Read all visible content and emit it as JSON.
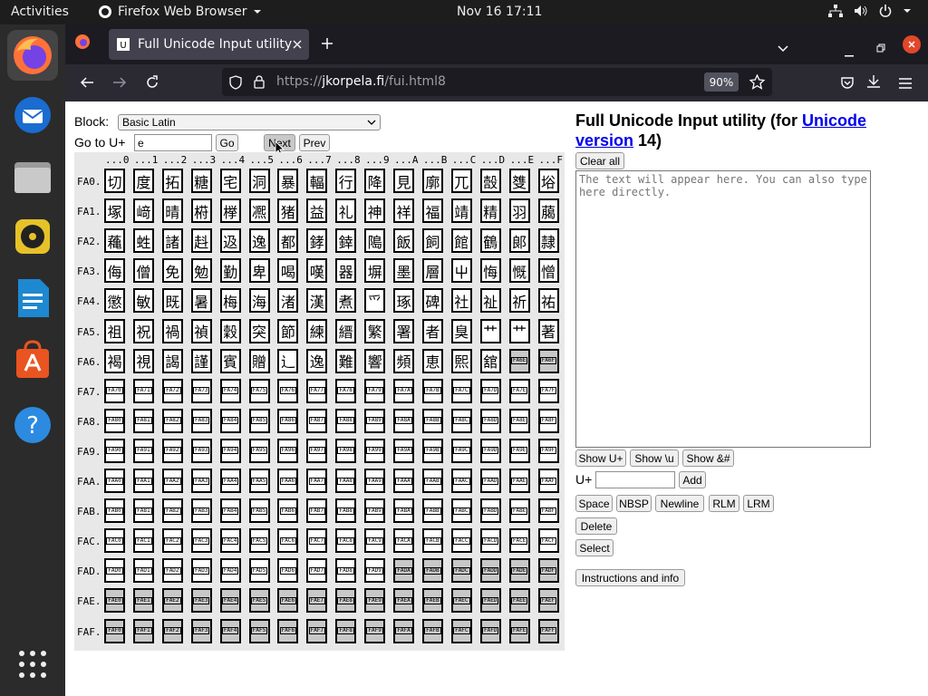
{
  "topbar": {
    "activities": "Activities",
    "app_name": "Firefox Web Browser",
    "datetime": "Nov 16  17:11"
  },
  "browser": {
    "tab_title": "Full Unicode Input utility",
    "url_prefix": "https://",
    "url_domain": "jkorpela.fi",
    "url_path": "/fui.html8",
    "zoom": "90%"
  },
  "page": {
    "block_label": "Block:",
    "block_selected": "Basic Latin",
    "goto_label": "Go to U+",
    "goto_value": "e",
    "go_btn": "Go",
    "next_btn": "Next",
    "prev_btn": "Prev",
    "title_prefix": "Full Unicode Input utility (for ",
    "title_link_1": "Unicode",
    "title_link_2": "version",
    "title_suffix": " 14)",
    "clear_all": "Clear all",
    "text_placeholder": "The text will appear here. You can also type here directly.",
    "show_u": "Show U+",
    "show_bs": "Show \\u",
    "show_amp": "Show &#",
    "uplus_label": "U+",
    "add_btn": "Add",
    "space_btn": "Space",
    "nbsp_btn": "NBSP",
    "newline_btn": "Newline",
    "rlm_btn": "RLM",
    "lrm_btn": "LRM",
    "delete_btn": "Delete",
    "select_btn": "Select",
    "instructions_btn": "Instructions and info"
  },
  "grid": {
    "col_headers": [
      "...0",
      "...1",
      "...2",
      "...3",
      "...4",
      "...5",
      "...6",
      "...7",
      "...8",
      "...9",
      "...A",
      "...B",
      "...C",
      "...D",
      "...E",
      "...F"
    ],
    "rows": [
      {
        "label": "FA0.",
        "cells": [
          "切",
          "度",
          "拓",
          "糖",
          "宅",
          "洞",
          "暴",
          "輻",
          "行",
          "降",
          "見",
          "廓",
          "兀",
          "嗀",
          "﨎",
          "﨏"
        ]
      },
      {
        "label": "FA1.",
        "cells": [
          "塚",
          "﨑",
          "晴",
          "﨓",
          "﨔",
          "凞",
          "猪",
          "益",
          "礼",
          "神",
          "祥",
          "福",
          "靖",
          "精",
          "羽",
          "﨟"
        ]
      },
      {
        "label": "FA2.",
        "cells": [
          "蘒",
          "﨡",
          "諸",
          "﨣",
          "﨤",
          "逸",
          "都",
          "﨧",
          "﨨",
          "﨩",
          "飯",
          "飼",
          "館",
          "鶴",
          "郞",
          "隷"
        ]
      },
      {
        "label": "FA3.",
        "cells": [
          "侮",
          "僧",
          "免",
          "勉",
          "勤",
          "卑",
          "喝",
          "嘆",
          "器",
          "塀",
          "墨",
          "層",
          "屮",
          "悔",
          "慨",
          "憎"
        ]
      },
      {
        "label": "FA4.",
        "cells": [
          "懲",
          "敏",
          "既",
          "暑",
          "梅",
          "海",
          "渚",
          "漢",
          "煮",
          "爫",
          "琢",
          "碑",
          "社",
          "祉",
          "祈",
          "祐"
        ]
      },
      {
        "label": "FA5.",
        "cells": [
          "祖",
          "祝",
          "禍",
          "禎",
          "穀",
          "突",
          "節",
          "練",
          "縉",
          "繁",
          "署",
          "者",
          "臭",
          "艹",
          "艹",
          "著"
        ]
      },
      {
        "label": "FA6.",
        "cells": [
          "褐",
          "視",
          "謁",
          "謹",
          "賓",
          "贈",
          "辶",
          "逸",
          "難",
          "響",
          "頻",
          "恵",
          "𤋮",
          "舘",
          "FA6E",
          "FA6F"
        ]
      },
      {
        "label": "FA7.",
        "cells": [
          "FA70",
          "FA71",
          "FA72",
          "FA73",
          "FA74",
          "FA75",
          "FA76",
          "FA77",
          "FA78",
          "FA79",
          "FA7A",
          "FA7B",
          "FA7C",
          "FA7D",
          "FA7E",
          "FA7F"
        ]
      },
      {
        "label": "FA8.",
        "cells": [
          "FA80",
          "FA81",
          "FA82",
          "FA83",
          "FA84",
          "FA85",
          "FA86",
          "FA87",
          "FA88",
          "FA89",
          "FA8A",
          "FA8B",
          "FA8C",
          "FA8D",
          "FA8E",
          "FA8F"
        ]
      },
      {
        "label": "FA9.",
        "cells": [
          "FA90",
          "FA91",
          "FA92",
          "FA93",
          "FA94",
          "FA95",
          "FA96",
          "FA97",
          "FA98",
          "FA99",
          "FA9A",
          "FA9B",
          "FA9C",
          "FA9D",
          "FA9E",
          "FA9F"
        ]
      },
      {
        "label": "FAA.",
        "cells": [
          "FAA0",
          "FAA1",
          "FAA2",
          "FAA3",
          "FAA4",
          "FAA5",
          "FAA6",
          "FAA7",
          "FAA8",
          "FAA9",
          "FAAA",
          "FAAB",
          "FAAC",
          "FAAD",
          "FAAE",
          "FAAF"
        ]
      },
      {
        "label": "FAB.",
        "cells": [
          "FAB0",
          "FAB1",
          "FAB2",
          "FAB3",
          "FAB4",
          "FAB5",
          "FAB6",
          "FAB7",
          "FAB8",
          "FAB9",
          "FABA",
          "FABB",
          "FABC",
          "FABD",
          "FABE",
          "FABF"
        ]
      },
      {
        "label": "FAC.",
        "cells": [
          "FAC0",
          "FAC1",
          "FAC2",
          "FAC3",
          "FAC4",
          "FAC5",
          "FAC6",
          "FAC7",
          "FAC8",
          "FAC9",
          "FACA",
          "FACB",
          "FACC",
          "FACD",
          "FACE",
          "FACF"
        ]
      },
      {
        "label": "FAD.",
        "cells": [
          "FAD0",
          "FAD1",
          "FAD2",
          "FAD3",
          "FAD4",
          "FAD5",
          "FAD6",
          "FAD7",
          "FAD8",
          "FAD9",
          "FADA",
          "FADB",
          "FADC",
          "FADD",
          "FADE",
          "FADF"
        ]
      },
      {
        "label": "FAE.",
        "cells": [
          "FAE0",
          "FAE1",
          "FAE2",
          "FAE3",
          "FAE4",
          "FAE5",
          "FAE6",
          "FAE7",
          "FAE8",
          "FAE9",
          "FAEA",
          "FAEB",
          "FAEC",
          "FAED",
          "FAEE",
          "FAEF"
        ]
      },
      {
        "label": "FAF.",
        "cells": [
          "FAF0",
          "FAF1",
          "FAF2",
          "FAF3",
          "FAF4",
          "FAF5",
          "FAF6",
          "FAF7",
          "FAF8",
          "FAF9",
          "FAFA",
          "FAFB",
          "FAFC",
          "FAFD",
          "FAFE",
          "FAFF"
        ]
      }
    ],
    "gray_cells": [
      "FA6E",
      "FA6F",
      "FADA",
      "FADB",
      "FADC",
      "FADD",
      "FADE",
      "FADF",
      "FAE0",
      "FAE1",
      "FAE2",
      "FAE3",
      "FAE4",
      "FAE5",
      "FAE6",
      "FAE7",
      "FAE8",
      "FAE9",
      "FAEA",
      "FAEB",
      "FAEC",
      "FAED",
      "FAEE",
      "FAEF",
      "FAF0",
      "FAF1",
      "FAF2",
      "FAF3",
      "FAF4",
      "FAF5",
      "FAF6",
      "FAF7",
      "FAF8",
      "FAF9",
      "FAFA",
      "FAFB",
      "FAFC",
      "FAFD",
      "FAFE",
      "FAFF"
    ]
  },
  "icons": {
    "firefox": "firefox-icon",
    "thunderbird": "thunderbird-icon",
    "files": "files-icon",
    "rhythmbox": "rhythmbox-icon",
    "writer": "writer-icon",
    "software": "software-icon",
    "help": "help-icon",
    "apps": "apps-grid-icon"
  },
  "colors": {
    "link": "#0000ee",
    "firefox_orange": "#ff7139",
    "close_red": "#e2472a"
  }
}
